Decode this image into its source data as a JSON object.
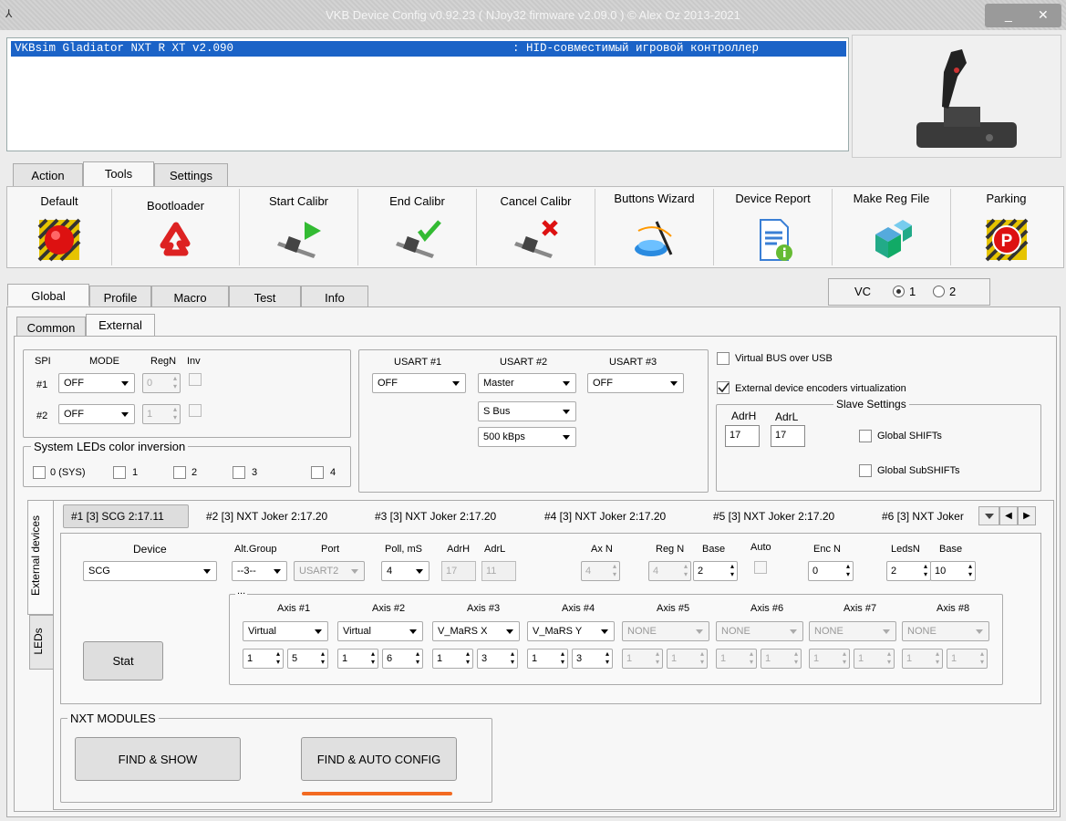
{
  "window": {
    "title": "VKB Device Config v0.92.23 ( NJoy32 firmware v2.09.0 ) © Alex Oz 2013-2021",
    "minimize": "_",
    "close": "✕"
  },
  "device_list": {
    "name": "VKBsim Gladiator NXT R  XT v2.090",
    "type": ": HID-совместимый игровой контроллер"
  },
  "top_tabs": [
    "Action",
    "Tools",
    "Settings"
  ],
  "toolbar": {
    "default": "Default",
    "bootloader": "Bootloader",
    "start_calibr": "Start Calibr",
    "end_calibr": "End Calibr",
    "cancel_calibr": "Cancel Calibr",
    "buttons_wizard": "Buttons Wizard",
    "device_report": "Device Report",
    "make_reg_file": "Make Reg File",
    "parking": "Parking"
  },
  "main_tabs": [
    "Global",
    "Profile",
    "Macro",
    "Test",
    "Info"
  ],
  "vc": {
    "label": "VC",
    "opt1": "1",
    "opt2": "2",
    "selected": "1"
  },
  "sub_tabs": [
    "Common",
    "External"
  ],
  "spi": {
    "spi": "SPI",
    "mode": "MODE",
    "regn": "RegN",
    "inv": "Inv",
    "row1": {
      "label": "#1",
      "mode": "OFF",
      "regn": "0"
    },
    "row2": {
      "label": "#2",
      "mode": "OFF",
      "regn": "1"
    }
  },
  "leds_inv": {
    "title": "System LEDs color inversion",
    "items": [
      "0 (SYS)",
      "1",
      "2",
      "3",
      "4"
    ]
  },
  "usart": {
    "h1": "USART #1",
    "h2": "USART #2",
    "h3": "USART #3",
    "u1": "OFF",
    "u2": "Master",
    "u2b": "S Bus",
    "u2c": "500 kBps",
    "u3": "OFF"
  },
  "virtual": {
    "vbus": "Virtual BUS over USB",
    "enc": "External device encoders virtualization",
    "slave": "Slave Settings",
    "adrh_label": "AdrH",
    "adrl_label": "AdrL",
    "adrh": "17",
    "adrl": "17",
    "gshifts": "Global SHIFTs",
    "gsubshifts": "Global SubSHIFTs"
  },
  "side_tabs": {
    "ext": "External devices",
    "leds": "LEDs"
  },
  "dev_tabs": [
    "#1 [3] SCG 2:17.11",
    "#2 [3] NXT Joker 2:17.20",
    "#3 [3] NXT Joker 2:17.20",
    "#4 [3] NXT Joker 2:17.20",
    "#5 [3] NXT Joker 2:17.20",
    "#6 [3] NXT Joker"
  ],
  "dev": {
    "h_device": "Device",
    "h_altgroup": "Alt.Group",
    "h_port": "Port",
    "h_poll": "Poll, mS",
    "h_adrh": "AdrH",
    "h_adrl": "AdrL",
    "h_axn": "Ax N",
    "h_regn": "Reg N",
    "h_base": "Base",
    "h_auto": "Auto",
    "h_encn": "Enc N",
    "h_ledsn": "LedsN",
    "h_base2": "Base",
    "device": "SCG",
    "altgroup": "--3--",
    "port": "USART2",
    "poll": "4",
    "adrh": "17",
    "adrl": "11",
    "axn": "4",
    "regn": "4",
    "base": "2",
    "encn": "0",
    "ledsn": "2",
    "base2": "10",
    "dots": "...",
    "stat": "Stat"
  },
  "axes": [
    {
      "h": "Axis #1",
      "v": "Virtual",
      "a": "1",
      "b": "5"
    },
    {
      "h": "Axis #2",
      "v": "Virtual",
      "a": "1",
      "b": "6"
    },
    {
      "h": "Axis #3",
      "v": "V_MaRS X",
      "a": "1",
      "b": "3"
    },
    {
      "h": "Axis #4",
      "v": "V_MaRS Y",
      "a": "1",
      "b": "3"
    },
    {
      "h": "Axis #5",
      "v": "NONE",
      "a": "1",
      "b": "1"
    },
    {
      "h": "Axis #6",
      "v": "NONE",
      "a": "1",
      "b": "1"
    },
    {
      "h": "Axis #7",
      "v": "NONE",
      "a": "1",
      "b": "1"
    },
    {
      "h": "Axis #8",
      "v": "NONE",
      "a": "1",
      "b": "1"
    }
  ],
  "nxt": {
    "title": "NXT MODULES",
    "find_show": "FIND &  SHOW",
    "find_auto": "FIND & AUTO CONFIG"
  },
  "colors": {
    "accent_underline": "#f26a21",
    "selection": "#1b63c7"
  }
}
